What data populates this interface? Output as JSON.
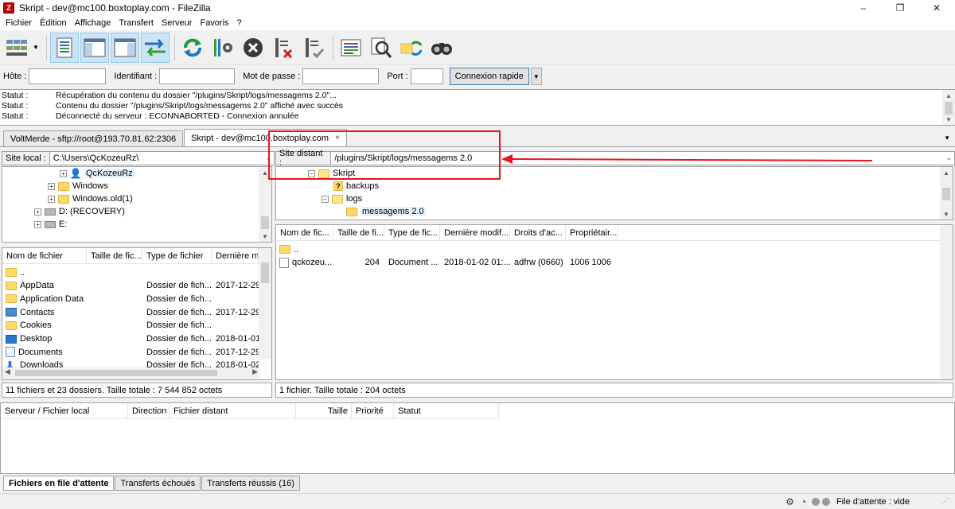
{
  "window": {
    "title": "Skript - dev@mc100.boxtoplay.com - FileZilla",
    "app_icon_letter": "Z",
    "controls": [
      "–",
      "❐",
      "✕"
    ]
  },
  "menu": [
    "Fichier",
    "Édition",
    "Affichage",
    "Transfert",
    "Serveur",
    "Favoris",
    "?"
  ],
  "toolbar": {
    "icons": [
      "site-manager-icon",
      "message-log-icon",
      "local-tree-icon",
      "remote-tree-icon",
      "transfer-queue-icon",
      "refresh-icon",
      "process-queue-icon",
      "cancel-icon",
      "disconnect-icon",
      "reconnect-icon",
      "filter-icon",
      "compare-icon",
      "sync-browsing-icon",
      "search-icon"
    ]
  },
  "quickconnect": {
    "host_label": "Hôte :",
    "user_label": "Identifiant :",
    "pass_label": "Mot de passe :",
    "port_label": "Port :",
    "host_value": "",
    "user_value": "",
    "pass_value": "",
    "port_value": "",
    "connect_button": "Connexion rapide"
  },
  "log": [
    {
      "key": "Statut :",
      "msg": "Récupération du contenu du dossier \"/plugins/Skript/logs/messagems 2.0\"..."
    },
    {
      "key": "Statut :",
      "msg": "Contenu du dossier \"/plugins/Skript/logs/messagems 2.0\" affiché avec succès"
    },
    {
      "key": "Statut :",
      "msg": "Déconnecté du serveur : ECONNABORTED - Connexion annulée"
    }
  ],
  "tabs": [
    {
      "label": "VoltMerde - sftp://root@193.70.81.62:2306",
      "active": false
    },
    {
      "label": "Skript - dev@mc100.boxtoplay.com",
      "active": true,
      "close": "×"
    }
  ],
  "local": {
    "site_label": "Site local :",
    "path": "C:\\Users\\QcKozeuRz\\",
    "tree": [
      {
        "label": "QcKozeuRz",
        "expander": "+",
        "icon": "user"
      },
      {
        "label": "Windows",
        "expander": "+",
        "icon": "folder"
      },
      {
        "label": "Windows.old(1)",
        "expander": "+",
        "icon": "folder"
      },
      {
        "label": "D: (RECOVERY)",
        "expander": "+",
        "icon": "drive"
      },
      {
        "label": "E:",
        "expander": "+",
        "icon": "drive"
      }
    ],
    "columns": [
      "Nom de fichier",
      "Taille de fic...",
      "Type de fichier",
      "Dernière mo"
    ],
    "rows": [
      {
        "name": "..",
        "size": "",
        "type": "",
        "date": "",
        "icon": "folder"
      },
      {
        "name": "AppData",
        "size": "",
        "type": "Dossier de fich...",
        "date": "2017-12-29",
        "icon": "folder"
      },
      {
        "name": "Application Data",
        "size": "",
        "type": "Dossier de fich...",
        "date": "",
        "icon": "folder"
      },
      {
        "name": "Contacts",
        "size": "",
        "type": "Dossier de fich...",
        "date": "2017-12-29",
        "icon": "contact"
      },
      {
        "name": "Cookies",
        "size": "",
        "type": "Dossier de fich...",
        "date": "",
        "icon": "folder"
      },
      {
        "name": "Desktop",
        "size": "",
        "type": "Dossier de fich...",
        "date": "2018-01-01",
        "icon": "desktop"
      },
      {
        "name": "Documents",
        "size": "",
        "type": "Dossier de fich...",
        "date": "2017-12-29",
        "icon": "docs"
      },
      {
        "name": "Downloads",
        "size": "",
        "type": "Dossier de fich...",
        "date": "2018-01-02",
        "icon": "down"
      }
    ],
    "status": "11 fichiers et 23 dossiers. Taille totale : 7 544 852 octets"
  },
  "remote": {
    "site_label": "Site distant :",
    "path": "/plugins/Skript/logs/messagems 2.0",
    "tree": [
      {
        "label": "Skript",
        "expander": "−",
        "icon": "folder"
      },
      {
        "label": "backups",
        "expander": "",
        "icon": "unknown",
        "mark": "?"
      },
      {
        "label": "logs",
        "expander": "−",
        "icon": "folder"
      },
      {
        "label": "messagems 2.0",
        "expander": "",
        "icon": "folder"
      }
    ],
    "columns": [
      "Nom de fic...",
      "Taille de fi...",
      "Type de fic...",
      "Dernière modif...",
      "Droits d'ac...",
      "Propriétair..."
    ],
    "rows": [
      {
        "name": "..",
        "size": "",
        "type": "",
        "date": "",
        "perms": "",
        "owner": "",
        "icon": "folder"
      },
      {
        "name": "qckozeu...",
        "size": "204",
        "type": "Document ...",
        "date": "2018-01-02 01:...",
        "perms": "adfrw (0660)",
        "owner": "1006 1006",
        "icon": "file"
      }
    ],
    "status": "1 fichier. Taille totale : 204 octets"
  },
  "queue": {
    "columns": [
      "Serveur / Fichier local",
      "Direction",
      "Fichier distant",
      "Taille",
      "Priorité",
      "Statut"
    ],
    "tabs": [
      {
        "label": "Fichiers en file d'attente",
        "active": true
      },
      {
        "label": "Transferts échoués",
        "active": false
      },
      {
        "label": "Transferts réussis (16)",
        "active": false
      }
    ]
  },
  "statusbar": {
    "queue_text": "File d'attente : vide"
  },
  "colors": {
    "annotation": "#e8141b",
    "selection": "#cce4f7",
    "folder": "#ffd867"
  }
}
